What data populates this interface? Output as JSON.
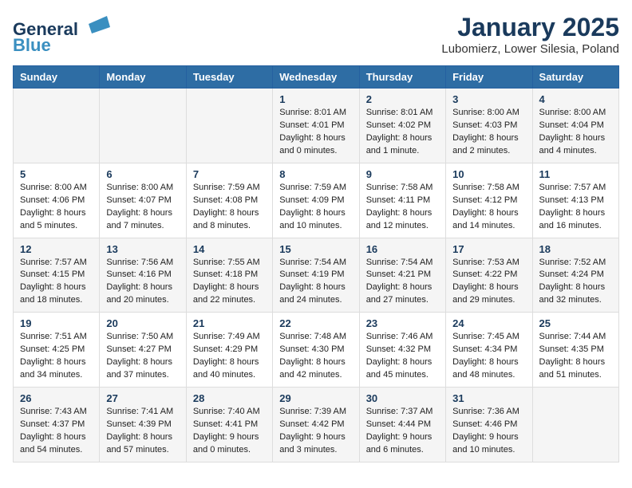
{
  "header": {
    "logo_line1": "General",
    "logo_line2": "Blue",
    "title": "January 2025",
    "subtitle": "Lubomierz, Lower Silesia, Poland"
  },
  "weekdays": [
    "Sunday",
    "Monday",
    "Tuesday",
    "Wednesday",
    "Thursday",
    "Friday",
    "Saturday"
  ],
  "weeks": [
    [
      {
        "day": "",
        "lines": []
      },
      {
        "day": "",
        "lines": []
      },
      {
        "day": "",
        "lines": []
      },
      {
        "day": "1",
        "lines": [
          "Sunrise: 8:01 AM",
          "Sunset: 4:01 PM",
          "Daylight: 8 hours",
          "and 0 minutes."
        ]
      },
      {
        "day": "2",
        "lines": [
          "Sunrise: 8:01 AM",
          "Sunset: 4:02 PM",
          "Daylight: 8 hours",
          "and 1 minute."
        ]
      },
      {
        "day": "3",
        "lines": [
          "Sunrise: 8:00 AM",
          "Sunset: 4:03 PM",
          "Daylight: 8 hours",
          "and 2 minutes."
        ]
      },
      {
        "day": "4",
        "lines": [
          "Sunrise: 8:00 AM",
          "Sunset: 4:04 PM",
          "Daylight: 8 hours",
          "and 4 minutes."
        ]
      }
    ],
    [
      {
        "day": "5",
        "lines": [
          "Sunrise: 8:00 AM",
          "Sunset: 4:06 PM",
          "Daylight: 8 hours",
          "and 5 minutes."
        ]
      },
      {
        "day": "6",
        "lines": [
          "Sunrise: 8:00 AM",
          "Sunset: 4:07 PM",
          "Daylight: 8 hours",
          "and 7 minutes."
        ]
      },
      {
        "day": "7",
        "lines": [
          "Sunrise: 7:59 AM",
          "Sunset: 4:08 PM",
          "Daylight: 8 hours",
          "and 8 minutes."
        ]
      },
      {
        "day": "8",
        "lines": [
          "Sunrise: 7:59 AM",
          "Sunset: 4:09 PM",
          "Daylight: 8 hours",
          "and 10 minutes."
        ]
      },
      {
        "day": "9",
        "lines": [
          "Sunrise: 7:58 AM",
          "Sunset: 4:11 PM",
          "Daylight: 8 hours",
          "and 12 minutes."
        ]
      },
      {
        "day": "10",
        "lines": [
          "Sunrise: 7:58 AM",
          "Sunset: 4:12 PM",
          "Daylight: 8 hours",
          "and 14 minutes."
        ]
      },
      {
        "day": "11",
        "lines": [
          "Sunrise: 7:57 AM",
          "Sunset: 4:13 PM",
          "Daylight: 8 hours",
          "and 16 minutes."
        ]
      }
    ],
    [
      {
        "day": "12",
        "lines": [
          "Sunrise: 7:57 AM",
          "Sunset: 4:15 PM",
          "Daylight: 8 hours",
          "and 18 minutes."
        ]
      },
      {
        "day": "13",
        "lines": [
          "Sunrise: 7:56 AM",
          "Sunset: 4:16 PM",
          "Daylight: 8 hours",
          "and 20 minutes."
        ]
      },
      {
        "day": "14",
        "lines": [
          "Sunrise: 7:55 AM",
          "Sunset: 4:18 PM",
          "Daylight: 8 hours",
          "and 22 minutes."
        ]
      },
      {
        "day": "15",
        "lines": [
          "Sunrise: 7:54 AM",
          "Sunset: 4:19 PM",
          "Daylight: 8 hours",
          "and 24 minutes."
        ]
      },
      {
        "day": "16",
        "lines": [
          "Sunrise: 7:54 AM",
          "Sunset: 4:21 PM",
          "Daylight: 8 hours",
          "and 27 minutes."
        ]
      },
      {
        "day": "17",
        "lines": [
          "Sunrise: 7:53 AM",
          "Sunset: 4:22 PM",
          "Daylight: 8 hours",
          "and 29 minutes."
        ]
      },
      {
        "day": "18",
        "lines": [
          "Sunrise: 7:52 AM",
          "Sunset: 4:24 PM",
          "Daylight: 8 hours",
          "and 32 minutes."
        ]
      }
    ],
    [
      {
        "day": "19",
        "lines": [
          "Sunrise: 7:51 AM",
          "Sunset: 4:25 PM",
          "Daylight: 8 hours",
          "and 34 minutes."
        ]
      },
      {
        "day": "20",
        "lines": [
          "Sunrise: 7:50 AM",
          "Sunset: 4:27 PM",
          "Daylight: 8 hours",
          "and 37 minutes."
        ]
      },
      {
        "day": "21",
        "lines": [
          "Sunrise: 7:49 AM",
          "Sunset: 4:29 PM",
          "Daylight: 8 hours",
          "and 40 minutes."
        ]
      },
      {
        "day": "22",
        "lines": [
          "Sunrise: 7:48 AM",
          "Sunset: 4:30 PM",
          "Daylight: 8 hours",
          "and 42 minutes."
        ]
      },
      {
        "day": "23",
        "lines": [
          "Sunrise: 7:46 AM",
          "Sunset: 4:32 PM",
          "Daylight: 8 hours",
          "and 45 minutes."
        ]
      },
      {
        "day": "24",
        "lines": [
          "Sunrise: 7:45 AM",
          "Sunset: 4:34 PM",
          "Daylight: 8 hours",
          "and 48 minutes."
        ]
      },
      {
        "day": "25",
        "lines": [
          "Sunrise: 7:44 AM",
          "Sunset: 4:35 PM",
          "Daylight: 8 hours",
          "and 51 minutes."
        ]
      }
    ],
    [
      {
        "day": "26",
        "lines": [
          "Sunrise: 7:43 AM",
          "Sunset: 4:37 PM",
          "Daylight: 8 hours",
          "and 54 minutes."
        ]
      },
      {
        "day": "27",
        "lines": [
          "Sunrise: 7:41 AM",
          "Sunset: 4:39 PM",
          "Daylight: 8 hours",
          "and 57 minutes."
        ]
      },
      {
        "day": "28",
        "lines": [
          "Sunrise: 7:40 AM",
          "Sunset: 4:41 PM",
          "Daylight: 9 hours",
          "and 0 minutes."
        ]
      },
      {
        "day": "29",
        "lines": [
          "Sunrise: 7:39 AM",
          "Sunset: 4:42 PM",
          "Daylight: 9 hours",
          "and 3 minutes."
        ]
      },
      {
        "day": "30",
        "lines": [
          "Sunrise: 7:37 AM",
          "Sunset: 4:44 PM",
          "Daylight: 9 hours",
          "and 6 minutes."
        ]
      },
      {
        "day": "31",
        "lines": [
          "Sunrise: 7:36 AM",
          "Sunset: 4:46 PM",
          "Daylight: 9 hours",
          "and 10 minutes."
        ]
      },
      {
        "day": "",
        "lines": []
      }
    ]
  ]
}
